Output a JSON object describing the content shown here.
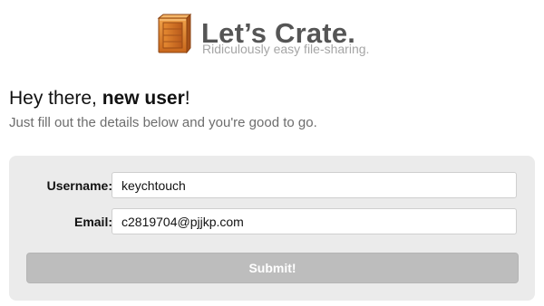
{
  "brand": {
    "name": "Let’s Crate.",
    "tagline": "Ridiculously easy file-sharing.",
    "logo_icon": "crate-icon"
  },
  "heading": {
    "greeting_prefix": "Hey there,",
    "greeting_bold": "new user",
    "greeting_suffix": "!",
    "subtitle": "Just fill out the details below and you're good to go."
  },
  "form": {
    "username": {
      "label": "Username:",
      "value": "keychtouch"
    },
    "email": {
      "label": "Email:",
      "value": "c2819704@pjjkp.com"
    },
    "submit_label": "Submit!"
  },
  "colors": {
    "panel_background": "#ebebeb",
    "submit_background": "#bdbdbd",
    "brand_text": "#555555",
    "tagline_text": "#a6a6a6",
    "crate_wood": "#d9822b"
  }
}
